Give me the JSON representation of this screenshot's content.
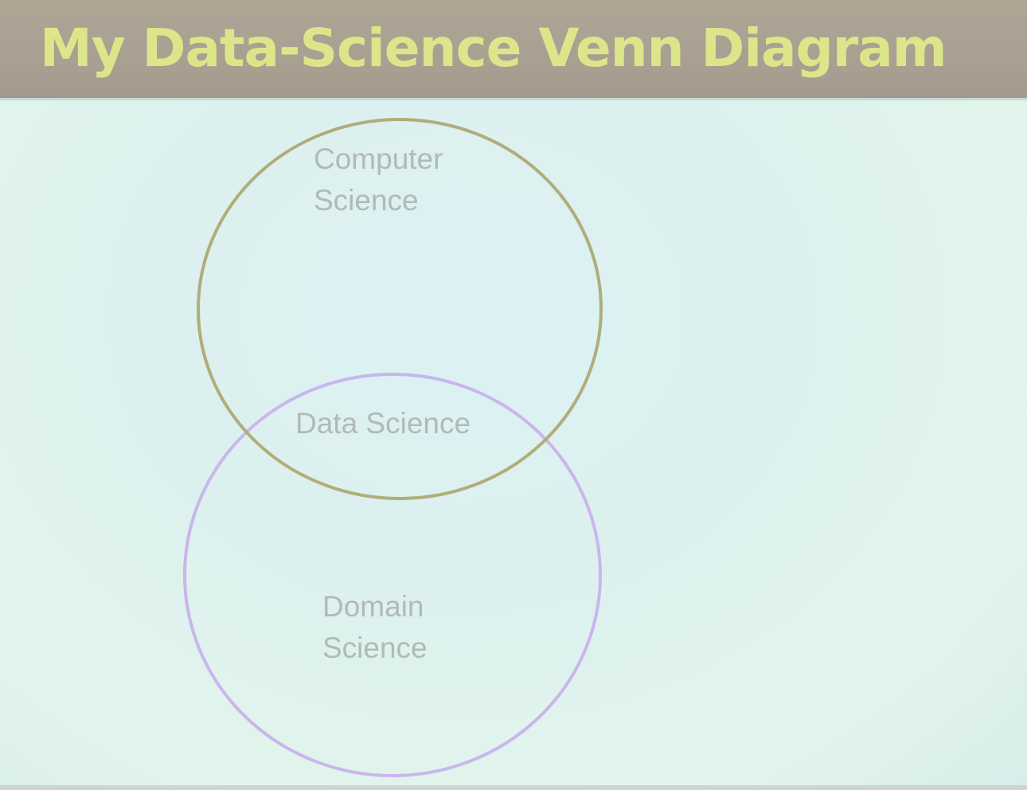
{
  "slide": {
    "title": "My Data-Science Venn Diagram"
  },
  "venn": {
    "sets": [
      {
        "label_line1": "Computer",
        "label_line2": "Science",
        "color": "#b0ad7a"
      },
      {
        "label_line1": "Domain",
        "label_line2": "Science",
        "color": "#c9b6ec"
      }
    ],
    "intersection_label": "Data Science"
  },
  "colors": {
    "title_bar": "#a9a092",
    "title_text": "#dde58a",
    "background": "#dcf1ef",
    "label_text": "#b1bab7"
  }
}
